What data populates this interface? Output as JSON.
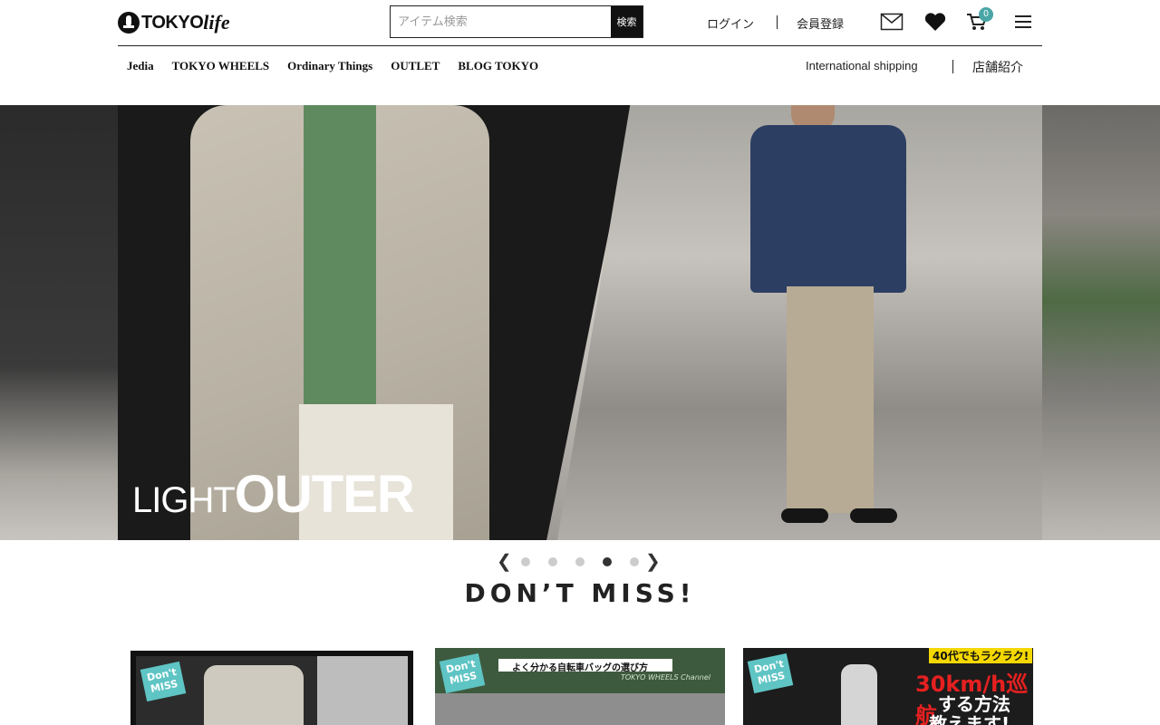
{
  "header": {
    "logo_text": "TOKYO",
    "logo_sub": "life",
    "search_placeholder": "アイテム検索",
    "search_button": "検索",
    "login": "ログイン",
    "register": "会員登録",
    "cart_count": "0"
  },
  "nav": {
    "items": [
      "Jedia",
      "TOKYO WHEELS",
      "Ordinary Things",
      "OUTLET",
      "BLOG TOKYO"
    ],
    "international": "International shipping",
    "stores": "店舗紹介"
  },
  "hero": {
    "title_light": "LIGHT",
    "title_bold": "OUTER",
    "active_slide": 4,
    "slide_count": 5
  },
  "section": {
    "title": "DON’T MISS!"
  },
  "cards": [
    {
      "badge": "Don't MISS"
    },
    {
      "badge": "Don't MISS",
      "caption": "よく分かる自転車バッグの選び方",
      "sub": "TOKYO WHEELS Channel"
    },
    {
      "badge": "Don't MISS",
      "caption": "40代でもラクラク!",
      "headline": "30km/h巡航",
      "headline2": "する方法",
      "headline3": "教えます!"
    }
  ],
  "colors": {
    "accent": "#4aa6a6",
    "badge": "#5fc4c4",
    "text": "#222222"
  }
}
